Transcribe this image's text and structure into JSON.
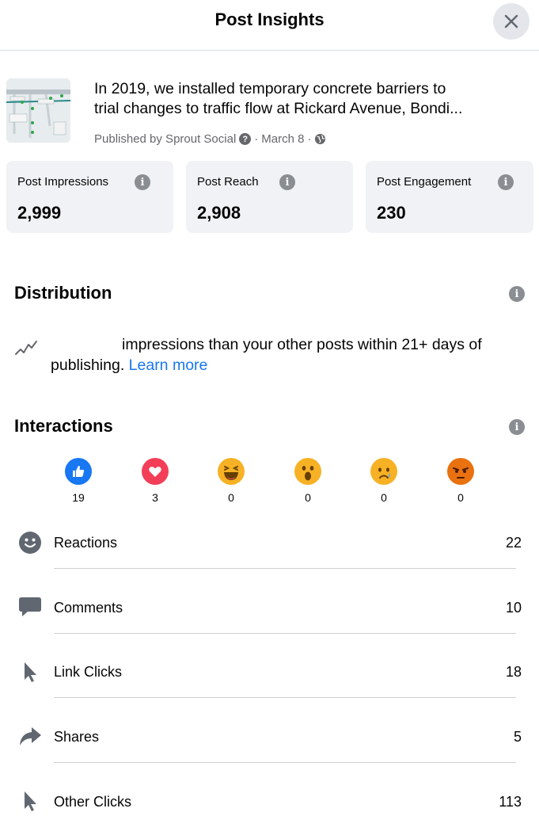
{
  "header": {
    "title": "Post Insights",
    "close_icon": "close-icon"
  },
  "post": {
    "text_line1": "In 2019, we installed temporary concrete barriers to",
    "text_line2": "trial changes to traffic flow at Rickard Avenue, Bondi...",
    "published_by": "Published by Sprout Social",
    "date": "March 8",
    "separator": "·"
  },
  "stats": [
    {
      "label": "Post Impressions",
      "value": "2,999"
    },
    {
      "label": "Post Reach",
      "value": "2,908"
    },
    {
      "label": "Post Engagement",
      "value": "230"
    }
  ],
  "distribution": {
    "title": "Distribution",
    "text": "impressions than your other posts within 21+ days of publishing.",
    "link": "Learn more"
  },
  "interactions": {
    "title": "Interactions",
    "reactions": [
      {
        "icon": "like-icon",
        "count": "19",
        "color": "#1877f2"
      },
      {
        "icon": "love-icon",
        "count": "3",
        "color": "#f33e58"
      },
      {
        "icon": "haha-icon",
        "count": "0",
        "color": "#f7b125"
      },
      {
        "icon": "wow-icon",
        "count": "0",
        "color": "#f7b125"
      },
      {
        "icon": "sad-icon",
        "count": "0",
        "color": "#f7b125"
      },
      {
        "icon": "angry-icon",
        "count": "0",
        "color": "#e9710f"
      }
    ],
    "rows": [
      {
        "icon": "smiley-icon",
        "label": "Reactions",
        "value": "22"
      },
      {
        "icon": "comment-icon",
        "label": "Comments",
        "value": "10"
      },
      {
        "icon": "cursor-icon",
        "label": "Link Clicks",
        "value": "18"
      },
      {
        "icon": "share-icon",
        "label": "Shares",
        "value": "5"
      },
      {
        "icon": "cursor-icon",
        "label": "Other Clicks",
        "value": "113"
      }
    ]
  }
}
